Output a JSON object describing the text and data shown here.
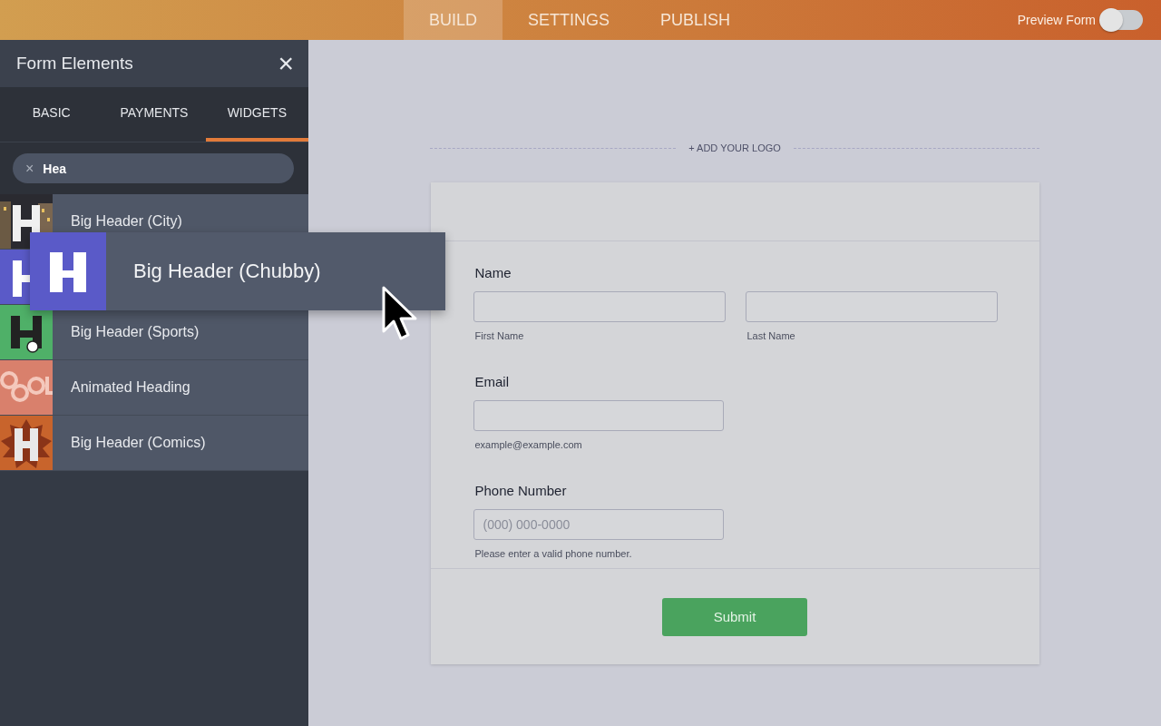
{
  "top_nav": {
    "tabs": [
      {
        "label": "BUILD",
        "selected": true
      },
      {
        "label": "SETTINGS",
        "selected": false
      },
      {
        "label": "PUBLISH",
        "selected": false
      }
    ],
    "preview": {
      "label": "Preview Form",
      "on": false
    }
  },
  "sidebar": {
    "title": "Form Elements",
    "close": "×",
    "tabs": [
      {
        "label": "BASIC",
        "selected": false
      },
      {
        "label": "PAYMENTS",
        "selected": false
      },
      {
        "label": "WIDGETS",
        "selected": true
      }
    ],
    "search": {
      "value": "Hea",
      "clear": "×"
    },
    "items": [
      {
        "kind": "city",
        "label": "Big Header (City)"
      },
      {
        "kind": "chubby"
      },
      {
        "kind": "sports",
        "label": "Big Header (Sports)"
      },
      {
        "kind": "cool",
        "label": "Animated Heading"
      },
      {
        "kind": "comics",
        "label": "Big Header (Comics)"
      }
    ],
    "dragged_item": {
      "kind": "chubby",
      "label": "Big Header (Chubby)"
    }
  },
  "form": {
    "add_logo": "+ ADD YOUR LOGO",
    "fields": [
      {
        "kind": "name",
        "label": "Name",
        "sublabels": [
          "First Name",
          "Last Name"
        ]
      },
      {
        "kind": "email",
        "label": "Email",
        "sublabels": [
          "example@example.com"
        ]
      },
      {
        "kind": "phone",
        "label": "Phone Number",
        "placeholder": "(000) 000-0000",
        "sublabels": [
          "Please enter a valid phone number."
        ]
      }
    ],
    "submit": "Submit"
  }
}
